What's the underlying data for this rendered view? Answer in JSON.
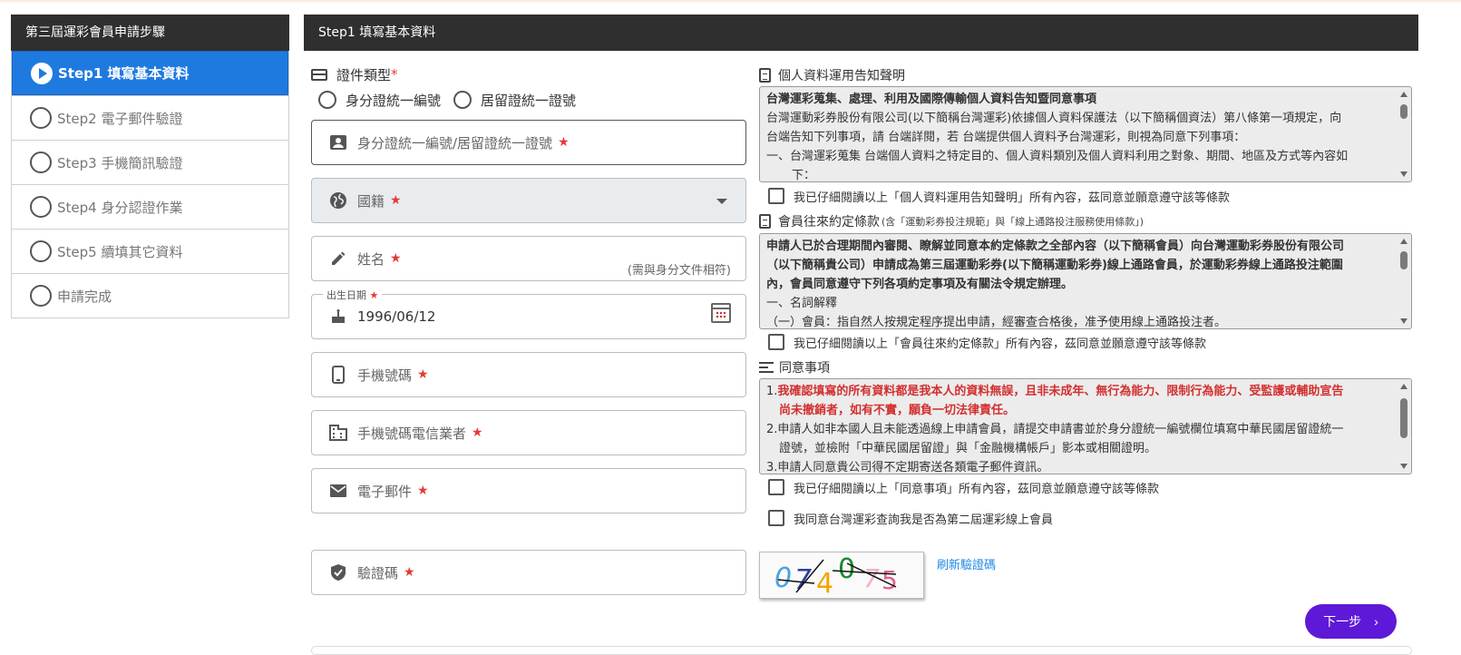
{
  "sidebar": {
    "title": "第三屆運彩會員申請步驟",
    "steps": [
      {
        "label": "Step1 填寫基本資料",
        "active": true
      },
      {
        "label": "Step2 電子郵件驗證"
      },
      {
        "label": "Step3 手機簡訊驗證"
      },
      {
        "label": "Step4 身分認證作業"
      },
      {
        "label": "Step5 續填其它資料"
      },
      {
        "label": "申請完成"
      }
    ]
  },
  "main": {
    "title": "Step1 填寫基本資料",
    "doc_type": {
      "label": "證件類型",
      "required_mark": "*",
      "options": [
        "身分證統一編號",
        "居留證統一證號"
      ]
    },
    "fields": {
      "id_number": {
        "placeholder": "身分證統一編號/居留證統一證號",
        "star": "★"
      },
      "nationality": {
        "placeholder": "國籍",
        "star": "★"
      },
      "name": {
        "placeholder": "姓名",
        "star": "★",
        "hint": "(需與身分文件相符)"
      },
      "birthday": {
        "legend": "出生日期",
        "star": "★",
        "value": "1996/06/12"
      },
      "mobile": {
        "placeholder": "手機號碼",
        "star": "★"
      },
      "carrier": {
        "placeholder": "手機號碼電信業者",
        "star": "★"
      },
      "email": {
        "placeholder": "電子郵件",
        "star": "★"
      },
      "captcha": {
        "placeholder": "驗證碼",
        "star": "★"
      }
    },
    "privacy": {
      "title": "個人資料運用告知聲明",
      "lines": [
        "台灣運彩蒐集、處理、利用及國際傳輸個人資料告知暨同意事項",
        "台灣運動彩券股份有限公司(以下簡稱台灣運彩)依據個人資料保護法（以下簡稱個資法）第八條第一項規定，向",
        "台端告知下列事項，請 台端詳閱，若 台端提供個人資料予台灣運彩，則視為同意下列事項：",
        "一、台灣運彩蒐集 台端個人資料之特定目的、個人資料類別及個人資料利用之對象、期間、地區及方式等內容如",
        "下："
      ],
      "agree": "我已仔細閱讀以上「個人資料運用告知聲明」所有內容，茲同意並願意遵守該等條款"
    },
    "terms": {
      "title": "會員往來約定條款",
      "subtitle": "(含「運動彩券投注規範」與「線上通路投注服務使用條款」)",
      "lines": [
        "申請人已於合理期間內審閱、瞭解並同意本約定條款之全部內容（以下簡稱會員）向台灣運動彩券股份有限公司",
        "（以下簡稱貴公司）申請成為第三屆運動彩券(以下簡稱運動彩券)線上通路會員，於運動彩券線上通路投注範圍",
        "內，會員同意遵守下列各項約定事項及有關法令規定辦理。",
        "一、名詞解釋",
        "（一）會員：指自然人按規定程序提出申請，經審查合格後，准予使用線上通路投注者。"
      ],
      "agree": "我已仔細閱讀以上「會員往來約定條款」所有內容，茲同意並願意遵守該等條款"
    },
    "consent": {
      "title": "同意事項",
      "item1_num": "1.",
      "item1_a": "我確認填寫的所有資料都是我本人的資料無誤，且非未成年、無行為能力、限制行為能力、受監護或輔助宣告",
      "item1_b": "尚未撤銷者，如有不實，願負一切法律責任。",
      "item2_a": "2.申請人如非本國人且未能透過線上申請會員，請提交申請書並於身分證統一編號欄位填寫中華民國居留證統一",
      "item2_b": "證號，並檢附「中華民國居留證」與「金融機構帳戶」影本或相關證明。",
      "item3": "3.申請人同意貴公司得不定期寄送各類電子郵件資訊。",
      "agree": "我已仔細閱讀以上「同意事項」所有內容，茲同意並願意遵守該等條款",
      "agree2": "我同意台灣運彩查詢我是否為第二屆運彩線上會員"
    },
    "captcha_chars": [
      "0",
      "7",
      "4",
      "0",
      "7",
      "5"
    ],
    "refresh": "刷新驗證碼",
    "next": "下一步",
    "next_arrow": "›"
  }
}
